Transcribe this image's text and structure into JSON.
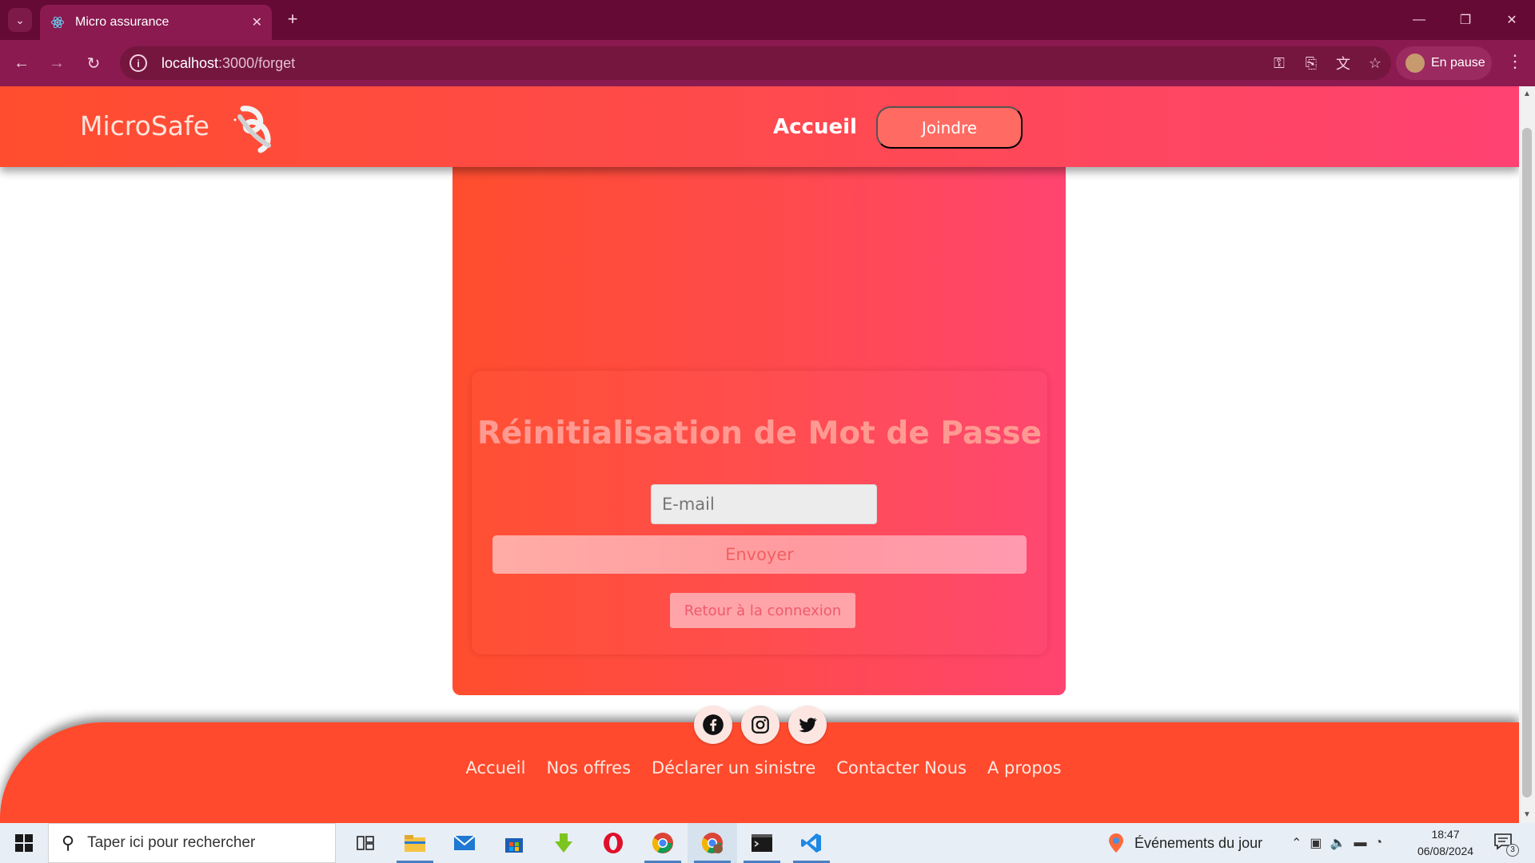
{
  "browser": {
    "tab_title": "Micro assurance",
    "url_host": "localhost",
    "url_path": ":3000/forget",
    "profile_label": "En pause"
  },
  "header": {
    "brand": "MicroSafe",
    "nav_home": "Accueil",
    "nav_join": "Joindre"
  },
  "reset": {
    "title": "Réinitialisation de Mot de Passe",
    "email_placeholder": "E-mail",
    "send_label": "Envoyer",
    "back_label": "Retour à la connexion"
  },
  "footer": {
    "links": [
      "Accueil",
      "Nos offres",
      "Déclarer un sinistre",
      "Contacter Nous",
      "A propos"
    ],
    "socials": [
      "facebook-icon",
      "instagram-icon",
      "twitter-icon"
    ]
  },
  "taskbar": {
    "search_placeholder": "Taper ici pour rechercher",
    "events_label": "Événements du jour",
    "time": "18:47",
    "date": "06/08/2024",
    "notification_count": "3"
  },
  "colors": {
    "chrome_dark": "#650a35",
    "chrome_toolbar": "#8a1a50",
    "brand_orange": "#ff4d2e",
    "brand_pink": "#ff4272"
  }
}
